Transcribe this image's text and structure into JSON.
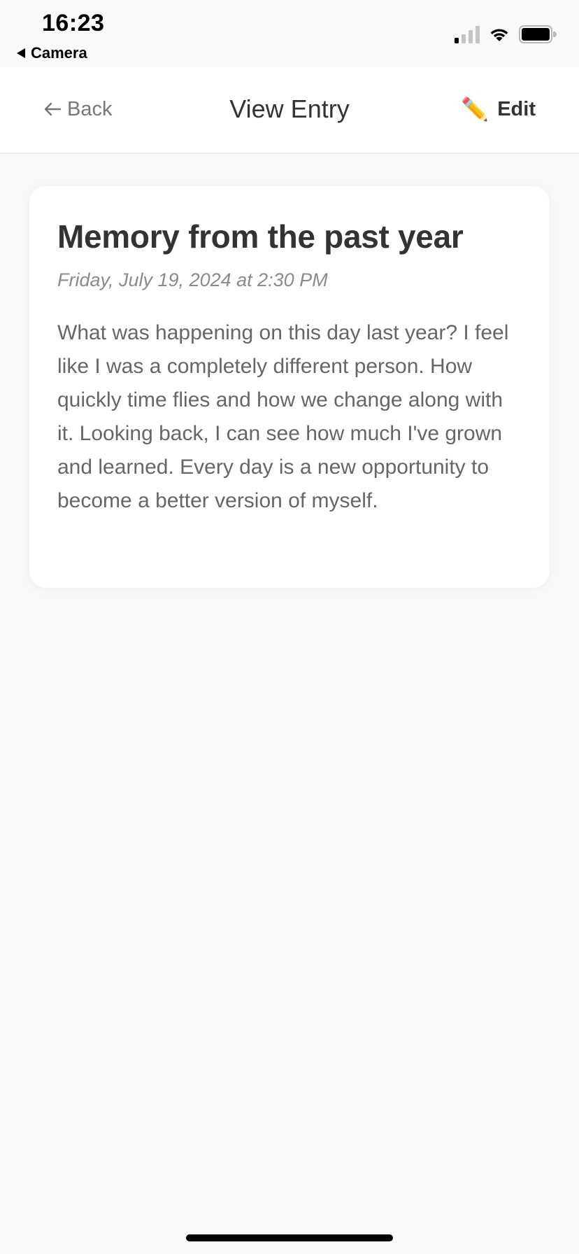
{
  "status_bar": {
    "time": "16:23",
    "back_app": "Camera",
    "signal_bars_active": 1,
    "signal_bars_total": 4
  },
  "nav": {
    "back_label": "Back",
    "title": "View Entry",
    "edit_label": "Edit",
    "edit_icon": "✏️"
  },
  "entry": {
    "title": "Memory from the past year",
    "date": "Friday, July 19, 2024 at 2:30 PM",
    "body": "What was happening on this day last year? I feel like I was a completely different person. How quickly time flies and how we change along with it. Looking back, I can see how much I've grown and learned. Every day is a new opportunity to become a better version of myself."
  },
  "colors": {
    "background": "#f9f9f9",
    "card": "#ffffff",
    "title_text": "#333333",
    "muted_text": "#777777",
    "body_text": "#666666"
  }
}
